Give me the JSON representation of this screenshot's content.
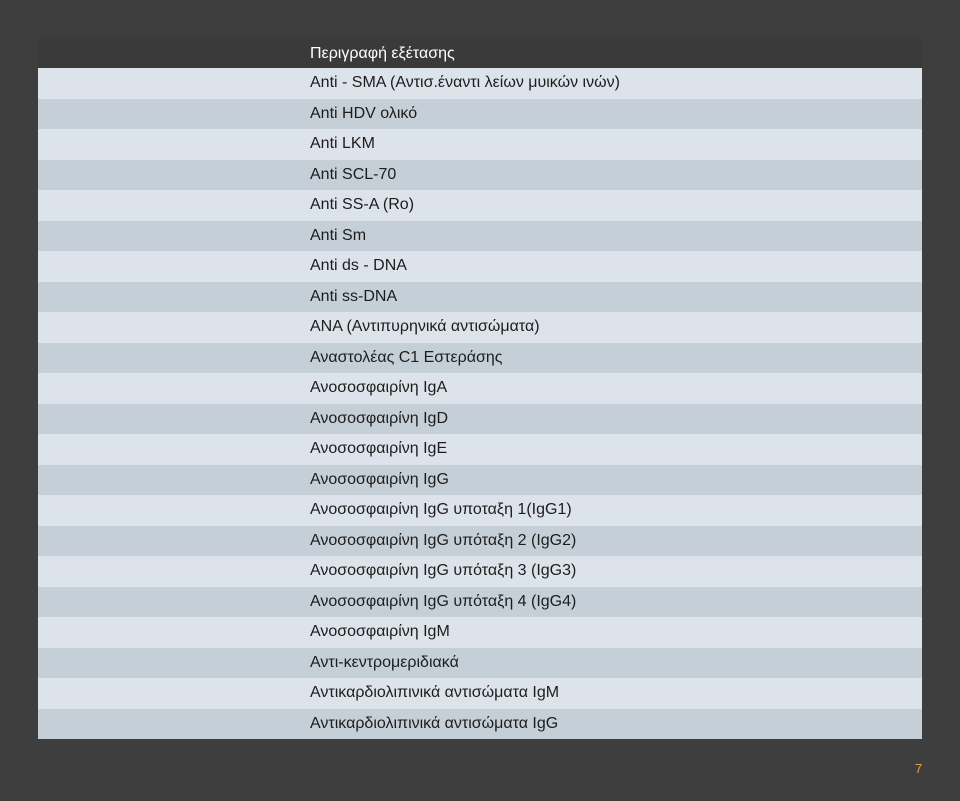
{
  "table": {
    "header": "Περιγραφή εξέτασης",
    "rows": [
      "Anti - SMA (Αντισ.έναντι λείων μυικών ινών)",
      "Anti HDV ολικό",
      "Anti LKM",
      "Anti SCL-70",
      "Anti SS-A (Ro)",
      "Anti Sm",
      "Anti ds - DNA",
      "Anti ss-DNA",
      "ANA (Αντιπυρηνικά αντισώματα)",
      "Αναστολέας C1 Εστεράσης",
      "Ανοσοσφαιρίνη IgA",
      "Ανοσοσφαιρίνη IgD",
      "Ανοσοσφαιρίνη IgE",
      "Ανοσοσφαιρίνη IgG",
      "Ανοσοσφαιρίνη IgG υποταξη 1(IgG1)",
      "Ανοσοσφαιρίνη IgG υπόταξη 2 (IgG2)",
      "Ανοσοσφαιρίνη IgG υπόταξη 3 (IgG3)",
      "Ανοσοσφαιρίνη IgG υπόταξη 4 (IgG4)",
      "Ανοσοσφαιρίνη IgM",
      "Αντι-κεντρομεριδιακά",
      "Αντικαρδιολιπινικά αντισώματα IgM",
      "Αντικαρδιολιπινικά αντισώματα IgG"
    ]
  },
  "page_number": "7",
  "colors": {
    "page_background": "#3e3e3e",
    "header_background": "#3a3a3a",
    "row_light": "#dde3ea",
    "row_dark": "#c5cfd7",
    "page_number": "#e8a23a"
  }
}
